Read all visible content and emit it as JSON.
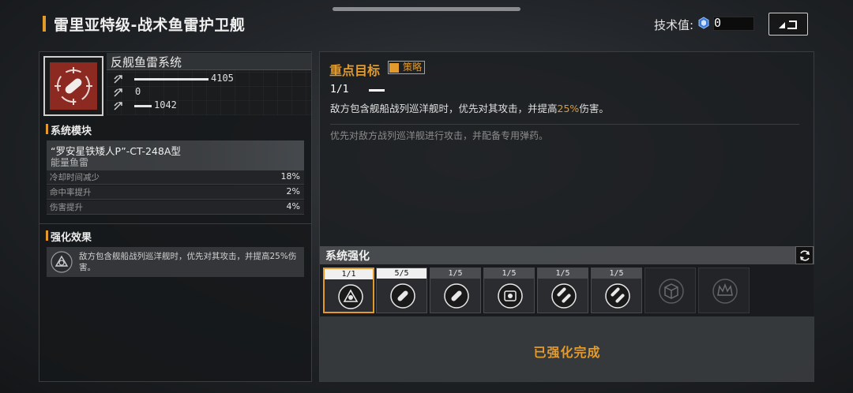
{
  "header": {
    "title": "雷里亚特级-战术鱼雷护卫舰",
    "tech_label": "技术值:",
    "tech_value": "0"
  },
  "weapon": {
    "name": "反舰鱼雷系统",
    "stats": [
      {
        "value": "4105",
        "fill": 0.85
      },
      {
        "value": "0",
        "fill": 0.0
      },
      {
        "value": "1042",
        "fill": 0.2
      }
    ]
  },
  "system_module": {
    "section_title": "系统模块",
    "module_name": "“罗安星铁矮人P”-CT-248A型",
    "module_type": "能量鱼雷",
    "rows": [
      {
        "label": "冷却时间减少",
        "value": "18%"
      },
      {
        "label": "命中率提升",
        "value": "2%"
      },
      {
        "label": "伤害提升",
        "value": "4%"
      }
    ]
  },
  "enhance_effect": {
    "section_title": "强化效果",
    "text": "敌方包含舰船战列巡洋舰时，优先对其攻击，并提高25%伤害。"
  },
  "focus_target": {
    "title": "重点目标",
    "tag": "策略",
    "level": "1/1",
    "desc_pre": "敌方包含舰船战列巡洋舰时，优先对其攻击，并提高",
    "desc_hl": "25%",
    "desc_post": "伤害。",
    "sub": "优先对敌方战列巡洋舰进行攻击，并配备专用弹药。"
  },
  "system_enhance": {
    "title": "系统强化",
    "tiles": [
      {
        "level": "1/1",
        "done": true,
        "selected": true,
        "icon": "ship-target-icon"
      },
      {
        "level": "5/5",
        "done": true,
        "selected": false,
        "icon": "torpedo-icon"
      },
      {
        "level": "1/5",
        "done": false,
        "selected": false,
        "icon": "torpedo-icon"
      },
      {
        "level": "1/5",
        "done": false,
        "selected": false,
        "icon": "radar-icon"
      },
      {
        "level": "1/5",
        "done": false,
        "selected": false,
        "icon": "double-torpedo-icon"
      },
      {
        "level": "1/5",
        "done": false,
        "selected": false,
        "icon": "double-torpedo-icon"
      },
      {
        "level": "",
        "done": false,
        "selected": false,
        "icon": "cube-icon",
        "locked": true
      },
      {
        "level": "",
        "done": false,
        "selected": false,
        "icon": "crown-icon",
        "locked": true
      }
    ],
    "complete_text": "已强化完成"
  },
  "colors": {
    "accent": "#e39a2c",
    "weapon_bg": "#8c2a22"
  }
}
